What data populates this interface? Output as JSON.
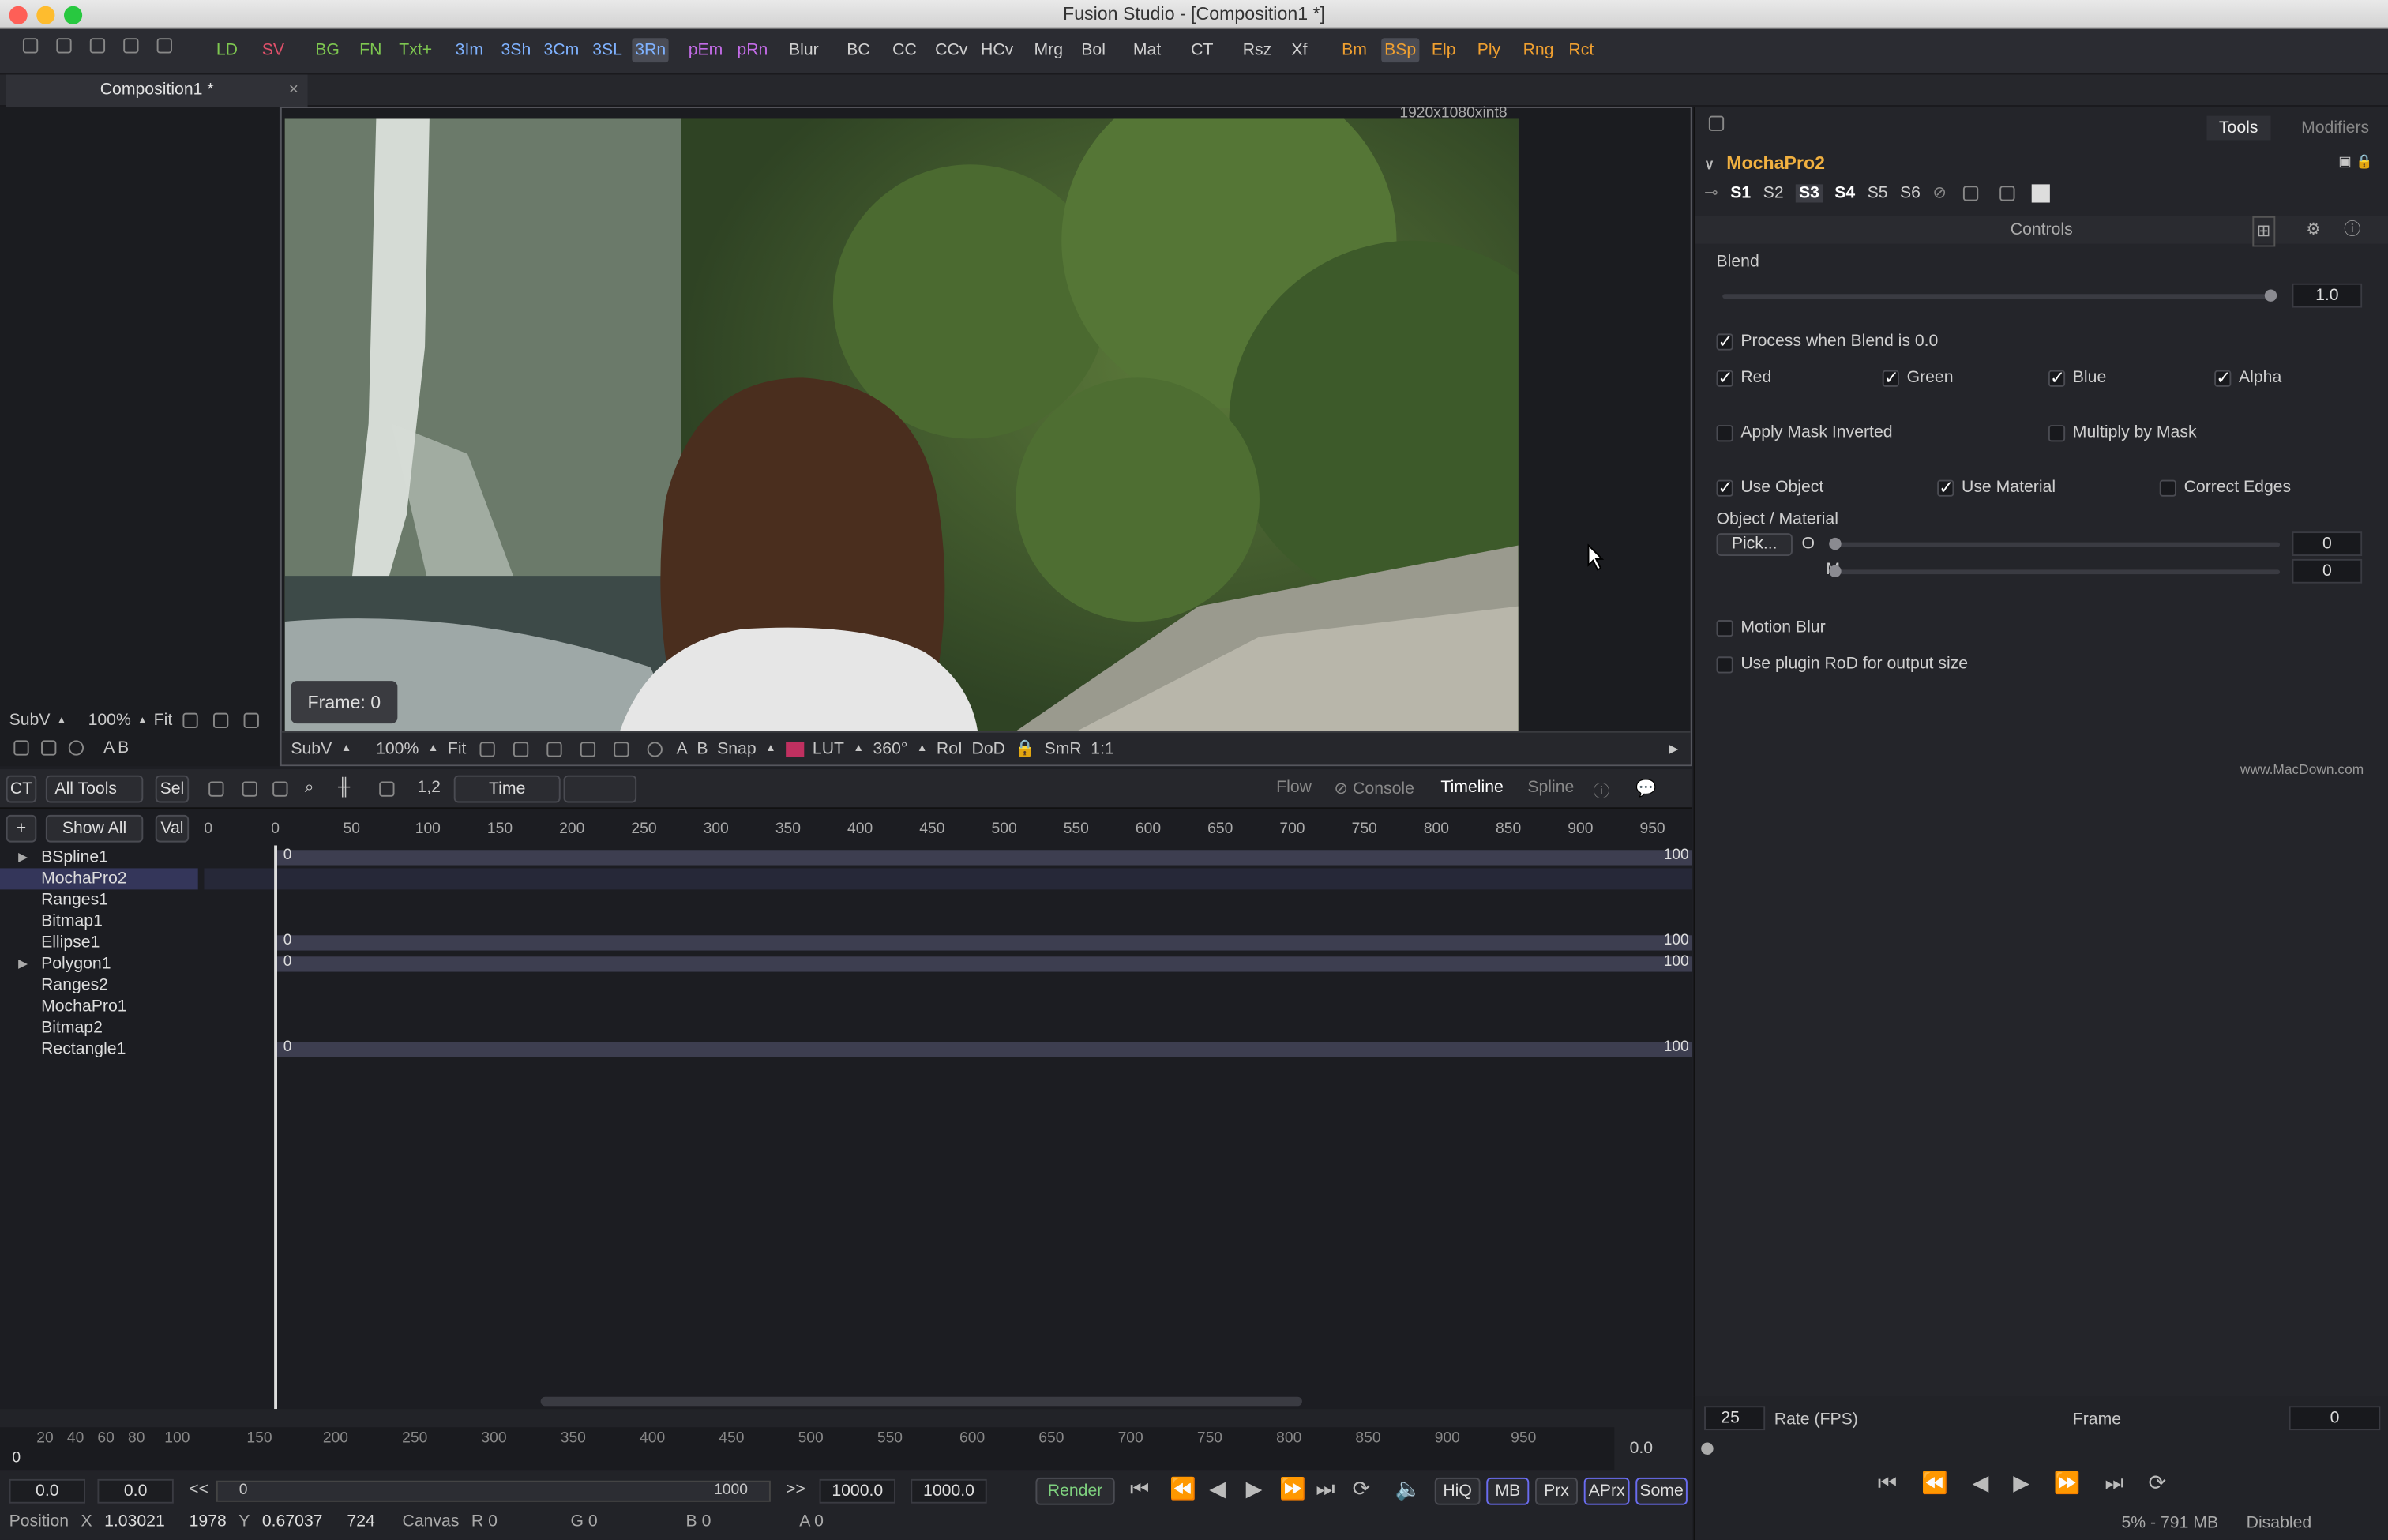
{
  "window": {
    "title": "Fusion Studio - [Composition1 *]"
  },
  "toolbar": {
    "buttons": [
      "LD",
      "SV",
      "BG",
      "FN",
      "Txt+",
      "3Im",
      "3Sh",
      "3Cm",
      "3SL",
      "3Rn",
      "pEm",
      "pRn",
      "Blur",
      "BC",
      "CC",
      "CCv",
      "HCv",
      "Mrg",
      "Bol",
      "Mat",
      "CT",
      "Rsz",
      "Xf",
      "Bm",
      "BSp",
      "Elp",
      "Ply",
      "Rng",
      "Rct"
    ],
    "colors": {
      "LD": "#7ec850",
      "SV": "#e0506a",
      "BG": "#7ec850",
      "FN": "#7ec850",
      "Txt+": "#7ec850",
      "3Im": "#7fb2ff",
      "3Sh": "#7fb2ff",
      "3Cm": "#7fb2ff",
      "3SL": "#7fb2ff",
      "3Rn": "#7fb2ff",
      "pEm": "#c46ce8",
      "pRn": "#c46ce8",
      "Bm": "#f0a030",
      "BSp": "#f0a030",
      "Elp": "#f0a030",
      "Ply": "#f0a030",
      "Rng": "#f0a030",
      "Rct": "#f0a030"
    },
    "selected": [
      "3Rn",
      "BSp"
    ]
  },
  "tab": {
    "label": "Composition1 *"
  },
  "viewer": {
    "resolution": "1920x1080xint8",
    "frame": "Frame: 0",
    "bar": {
      "subv": "SubV",
      "zoom": "100%",
      "fit": "Fit",
      "snap": "Snap",
      "lut": "LUT",
      "angle": "360°",
      "roi": "RoI",
      "dod": "DoD",
      "smr": "SmR",
      "ratio": "1:1"
    }
  },
  "left_viewer": {
    "subv": "SubV",
    "zoom": "100%",
    "fit": "Fit"
  },
  "inspector": {
    "tabs": [
      "Tools",
      "Modifiers"
    ],
    "tool_name": "MochaPro2",
    "sets": [
      "S1",
      "S2",
      "S3",
      "S4",
      "S5",
      "S6"
    ],
    "section": "Controls",
    "blend_label": "Blend",
    "blend_value": "1.0",
    "blend_fraction": 1.0,
    "process_label": "Process when Blend is 0.0",
    "red": "Red",
    "green": "Green",
    "blue": "Blue",
    "alpha": "Alpha",
    "apply_mask_inverted": "Apply Mask Inverted",
    "multiply_by_mask": "Multiply by Mask",
    "use_object": "Use Object",
    "use_material": "Use Material",
    "correct_edges": "Correct Edges",
    "object_material": "Object / Material",
    "pick": "Pick...",
    "o_label": "O",
    "o_value": "0",
    "m_label": "M",
    "m_value": "0",
    "motion_blur": "Motion Blur",
    "use_plugin_rod": "Use plugin RoD for output size",
    "watermark": "www.MacDown.com"
  },
  "timeline": {
    "toolbar": {
      "ct": "CT",
      "all_tools": "All Tools",
      "sel": "Sel",
      "num": "1,2",
      "time": "Time",
      "flow": "Flow",
      "console": "Console",
      "timeline": "Timeline",
      "spline": "Spline",
      "show_all": "Show All",
      "val": "Val"
    },
    "ruler": [
      "0",
      "50",
      "100",
      "150",
      "200",
      "250",
      "300",
      "350",
      "400",
      "450",
      "500",
      "550",
      "600",
      "650",
      "700",
      "750",
      "800",
      "850",
      "900",
      "950"
    ],
    "ruler_prefix": "0",
    "tracks": [
      "BSpline1",
      "MochaPro2",
      "Ranges1",
      "Bitmap1",
      "Ellipse1",
      "Polygon1",
      "Ranges2",
      "MochaPro1",
      "Bitmap2",
      "Rectangle1"
    ],
    "bar_start": "0",
    "bar_end": "100"
  },
  "transport": {
    "ruler": [
      "20",
      "40",
      "60",
      "80",
      "100",
      "150",
      "200",
      "250",
      "300",
      "350",
      "400",
      "450",
      "500",
      "550",
      "600",
      "650",
      "700",
      "750",
      "800",
      "850",
      "900",
      "950"
    ],
    "ruler_start": "0",
    "current_time": "0.0",
    "start": "0.0",
    "render_start": "0.0",
    "back": "<<",
    "fwd": ">>",
    "range_start_label": "0",
    "range_end_label": "1000",
    "end": "1000.0",
    "render_end": "1000.0",
    "render": "Render",
    "hiq": "HiQ",
    "mb": "MB",
    "prx": "Prx",
    "aprx": "APrx",
    "some": "Some"
  },
  "status": {
    "position": "Position",
    "x_label": "X",
    "x_value": "1.03021",
    "x_px": "1978",
    "y_label": "Y",
    "y_value": "0.67037",
    "y_px": "724",
    "canvas": "Canvas",
    "r": "R 0",
    "g": "G 0",
    "b": "B 0",
    "a": "A 0",
    "memory": "5% - 791 MB",
    "disabled": "Disabled"
  },
  "rate": {
    "fps": "25",
    "fps_label": "Rate (FPS)",
    "frame_label": "Frame",
    "frame_value": "0"
  }
}
